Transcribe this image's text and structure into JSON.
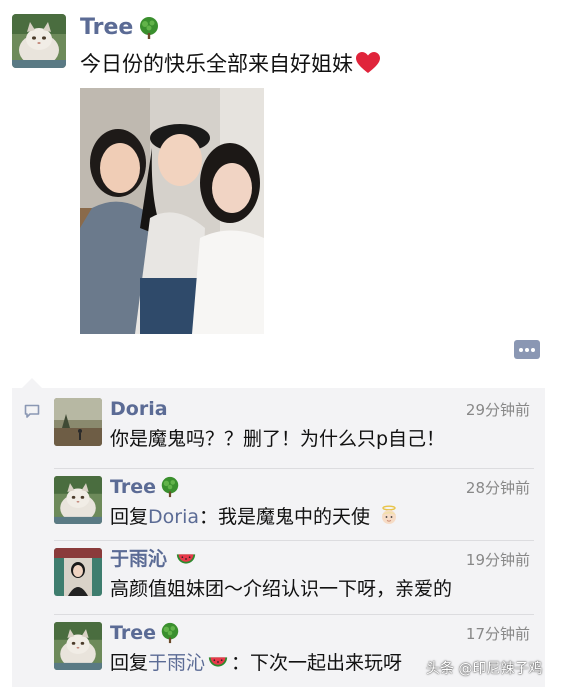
{
  "post": {
    "author": "Tree",
    "text": "今日份的快乐全部来自好姐妹"
  },
  "comments": [
    {
      "author": "Doria",
      "time": "29分钟前",
      "text": "你是魔鬼吗？？删了！为什么只p自己！"
    },
    {
      "author": "Tree",
      "time": "28分钟前",
      "reply_prefix": "回复",
      "reply_to": "Doria",
      "text": "：我是魔鬼中的天使"
    },
    {
      "author": "于雨沁",
      "time": "19分钟前",
      "text": "高颜值姐妹团～介绍认识一下呀，亲爱的"
    },
    {
      "author": "Tree",
      "time": "17分钟前",
      "reply_prefix": "回复",
      "reply_to": "于雨沁",
      "text": "：下次一起出来玩呀"
    }
  ],
  "watermark": "头条 @印尼辣子鸡",
  "icons": {
    "tree": "tree-emoji-icon",
    "heart": "red-heart-icon",
    "watermelon": "watermelon-emoji-icon",
    "angel": "baby-angel-emoji-icon",
    "comment": "comment-icon",
    "more": "more-options-icon"
  },
  "colors": {
    "link_blue": "#5b6b95",
    "heart_red": "#e0243b",
    "comment_bg": "#f3f3f5"
  }
}
